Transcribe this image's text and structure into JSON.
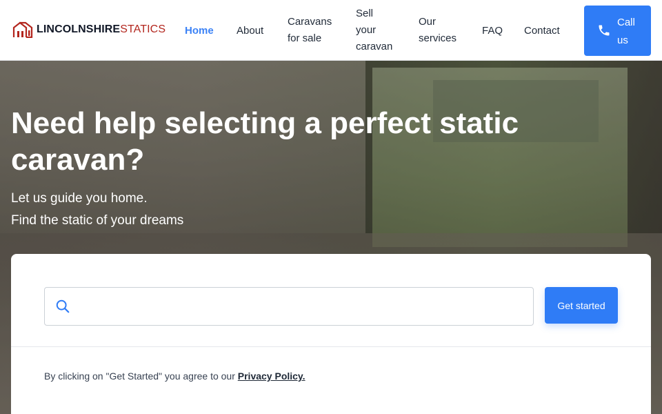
{
  "brand": {
    "part1": "LINCOLNSHIRE",
    "part2": "STATICS"
  },
  "nav": [
    {
      "id": "home",
      "label": "Home",
      "active": true
    },
    {
      "id": "about",
      "label": "About"
    },
    {
      "id": "caravans",
      "lines": [
        "Caravans",
        "for sale"
      ]
    },
    {
      "id": "sell",
      "lines": [
        "Sell",
        "your",
        "caravan"
      ]
    },
    {
      "id": "services",
      "lines": [
        "Our",
        "services"
      ]
    },
    {
      "id": "faq",
      "label": "FAQ"
    },
    {
      "id": "contact",
      "label": "Contact"
    }
  ],
  "call": {
    "lines": [
      "Call",
      "us"
    ],
    "icon": "phone-icon"
  },
  "hero": {
    "title": "Need help selecting a perfect static caravan?",
    "subtitle1": "Let us guide you home.",
    "subtitle2": "Find the static of your dreams"
  },
  "search": {
    "placeholder": "",
    "value": "",
    "icon": "search-icon",
    "button": "Get started"
  },
  "consent": {
    "text": "By clicking on \"Get Started\" you agree to our ",
    "link": "Privacy Policy."
  },
  "colors": {
    "accent": "#2f7cf6",
    "brand_red": "#b3261e",
    "active_nav": "#3b82f6"
  }
}
